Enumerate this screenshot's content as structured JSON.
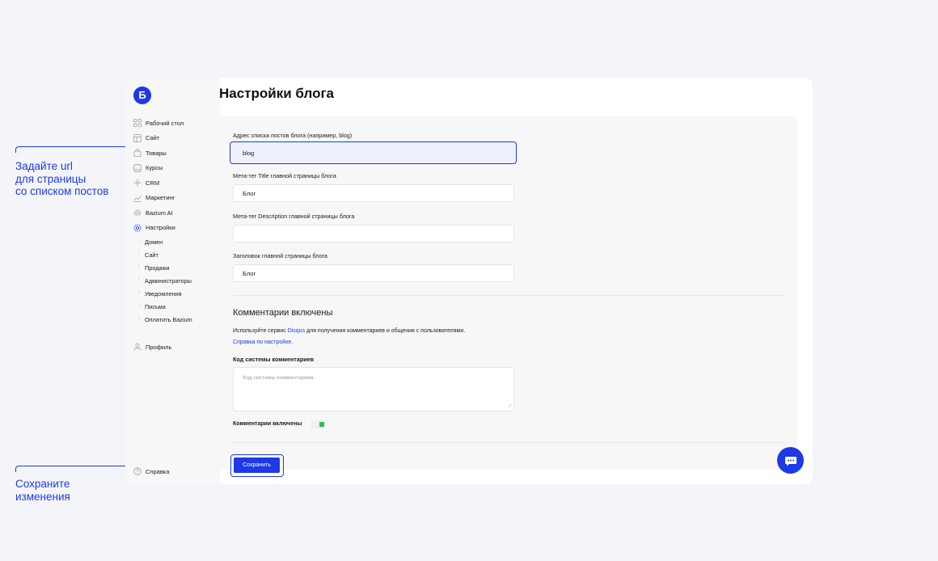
{
  "app": {
    "logo_letter": "Б",
    "page_title": "Настройки блога"
  },
  "sidebar": {
    "items": [
      {
        "label": "Рабочий стол",
        "icon": "dashboard-icon"
      },
      {
        "label": "Сайт",
        "icon": "layout-icon"
      },
      {
        "label": "Товары",
        "icon": "bag-icon"
      },
      {
        "label": "Курсы",
        "icon": "book-icon"
      },
      {
        "label": "CRM",
        "icon": "crm-icon"
      },
      {
        "label": "Маркетинг",
        "icon": "chart-icon"
      },
      {
        "label": "Bazium AI",
        "icon": "robot-icon"
      },
      {
        "label": "Настройки",
        "icon": "gear-icon"
      }
    ],
    "settings_subitems": [
      "Домен",
      "Сайт",
      "Продажи",
      "Администраторы",
      "Уведомления",
      "Письма",
      "Оплатить Bazium"
    ],
    "profile_label": "Профиль",
    "help_label": "Справка"
  },
  "form": {
    "blog_url_label": "Адрес списка постов блога (например, blog)",
    "blog_url_value": "blog",
    "meta_title_label": "Мета-тег Title главной страницы блога",
    "meta_title_value": "Блог",
    "meta_description_label": "Мета-тег Description главной страницы блога",
    "meta_description_value": "",
    "heading_label": "Заголовок главной страницы блога",
    "heading_value": "Блог"
  },
  "comments": {
    "section_title": "Комментарии включены",
    "info_prefix": "Используйте сервис ",
    "info_link": "Disqus",
    "info_suffix": " для получения комментариев и общения с пользователями.",
    "help_link": "Справка по настройке.",
    "code_label": "Код системы комментариев",
    "code_placeholder": "Код системы комментариев",
    "toggle_label": "Комментарии включены",
    "enabled": true
  },
  "actions": {
    "save_label": "Сохранить"
  },
  "annotations": {
    "url_hint": [
      "Задайте url",
      "для страницы",
      "со списком постов"
    ],
    "save_hint": [
      "Сохраните",
      "изменения"
    ]
  },
  "colors": {
    "accent": "#1e39e6",
    "toggle_on": "#2ec24f",
    "background": "#f4f5f9"
  }
}
